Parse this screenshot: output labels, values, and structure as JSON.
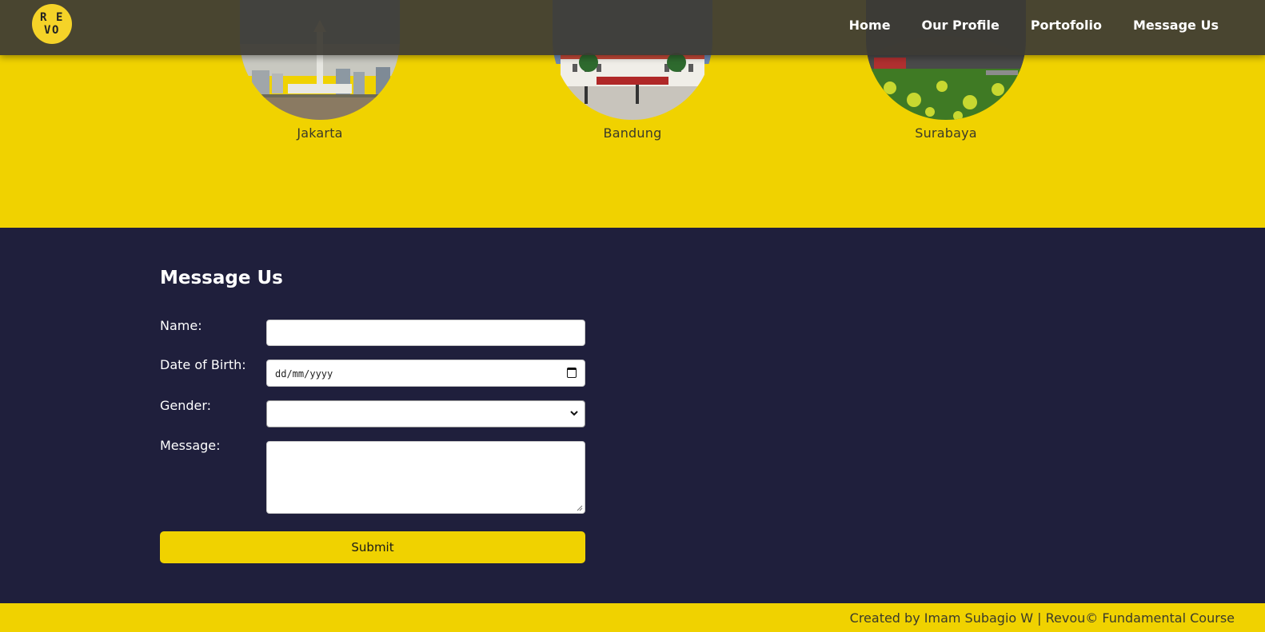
{
  "header": {
    "logo_letters": [
      "R",
      "E",
      "V",
      "O"
    ],
    "nav": [
      "Home",
      "Our Profile",
      "Portofolio",
      "Message Us"
    ]
  },
  "portfolio": {
    "cities": [
      {
        "name": "Jakarta",
        "icon": "jakarta-photo"
      },
      {
        "name": "Bandung",
        "icon": "bandung-photo"
      },
      {
        "name": "Surabaya",
        "icon": "surabaya-photo"
      }
    ]
  },
  "message_form": {
    "title": "Message Us",
    "name_label": "Name:",
    "name_value": "",
    "dob_label": "Date of Birth:",
    "dob_placeholder": "dd/mm/yyyy",
    "gender_label": "Gender:",
    "gender_value": "",
    "message_label": "Message:",
    "message_value": "",
    "submit_label": "Submit"
  },
  "footer": {
    "text": "Created by Imam Subagio W | Revou© Fundamental Course"
  },
  "colors": {
    "yellow": "#f0d200",
    "navy": "#1f1f3c",
    "header": "#3c3a34"
  }
}
